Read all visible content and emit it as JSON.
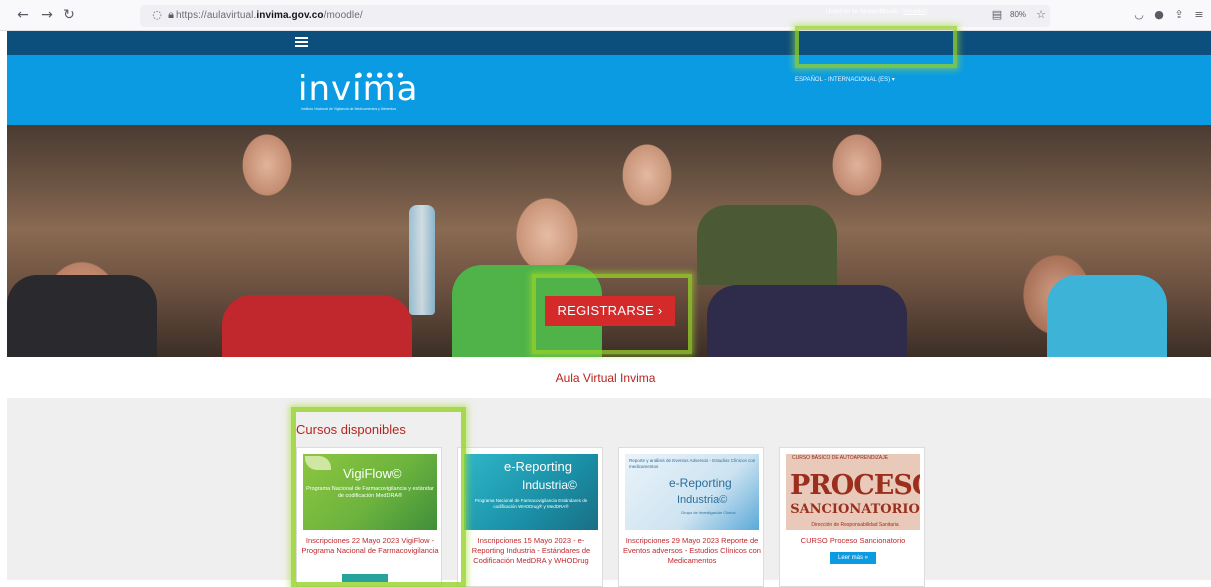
{
  "browser": {
    "url_prefix": "https://aulavirtual.",
    "url_domain": "invima.gov.co",
    "url_path": "/moodle/",
    "zoom": "80%"
  },
  "topbar": {
    "login_prefix": "Usted no se ha identificado. (",
    "login_link": "Acceder",
    "login_suffix": ")"
  },
  "header": {
    "logo": "invima",
    "logo_subtitle": "Instituto Nacional de Vigilancia de Medicamentos y Alimentos",
    "language": "ESPAÑOL - INTERNACIONAL (ES) ▾"
  },
  "hero": {
    "register_button": "REGISTRARSE ›"
  },
  "site_title": "Aula Virtual Invima",
  "courses": {
    "section_title": "Cursos disponibles",
    "cards": [
      {
        "img_title": "VigiFlow©",
        "img_subtitle": "Programa Nacional de Farmacovigilancia y estándar de codificación MedDRA®",
        "text": "Inscripciones 22 Mayo 2023 VigiFlow - Programa Nacional de Farmacovigilancia"
      },
      {
        "img_title": "e-Reporting",
        "img_title2": "Industria©",
        "img_subtitle": "Programa Nacional de Farmacovigilancia Estándares de codificación WHODrug® y MedDRA®",
        "text": "Inscripciones 15 Mayo 2023 - e-Reporting Industria - Estándares de Codificación MedDRA y WHODrug"
      },
      {
        "img_top": "Reporte y análisis de Eventos Adversos - Estudios Clínicos con medicamentos",
        "img_title": "e-Reporting",
        "img_title2": "Industria©",
        "img_subtitle": "Grupo de Investigación Clínica",
        "text": "Inscripciones 29 Mayo 2023 Reporte de Eventos adversos - Estudios Clínicos con Medicamentos"
      },
      {
        "img_top": "CURSO BÁSICO DE AUTOAPRENDIZAJE",
        "img_title": "PROCESO",
        "img_title2": "SANCIONATORIO",
        "img_subtitle": "Dirección de Responsabilidad Sanitaria",
        "text": "CURSO Proceso Sancionatorio",
        "button": "Leer más »"
      }
    ]
  },
  "colors": {
    "navy": "#0d4f7c",
    "header_blue": "#0b9be3",
    "accent_red": "#d42a2a",
    "highlight_green": "#96d228"
  }
}
